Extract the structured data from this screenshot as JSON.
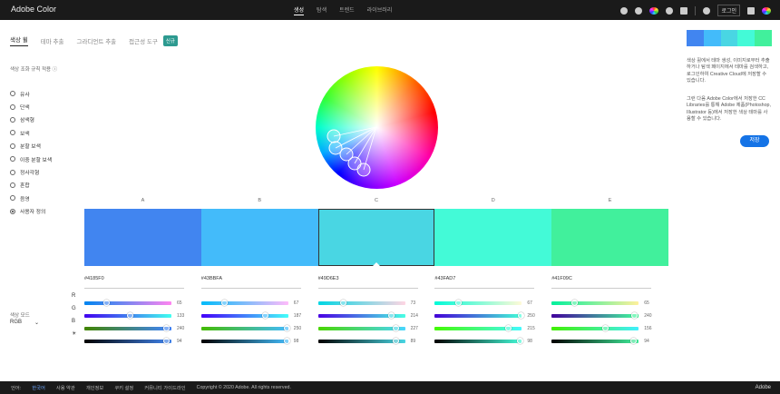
{
  "header": {
    "brand": "Adobe Color",
    "nav": [
      "생성",
      "탐색",
      "트렌드",
      "라이브러리"
    ],
    "login": "로그인"
  },
  "tabs": {
    "items": [
      "색상 휠",
      "테마 추출",
      "그라디언트 추출",
      "접근성 도구"
    ],
    "badge": "신규"
  },
  "harmony": {
    "label": "색상 조화 규칙 적용 ⓘ",
    "rules": [
      "유사",
      "단색",
      "삼색형",
      "보색",
      "분할 보색",
      "이중 분할 보색",
      "정사각형",
      "혼합",
      "음영",
      "사용자 정의"
    ],
    "selected": "사용자 정의"
  },
  "colormode": {
    "label": "색상 모드",
    "value": "RGB"
  },
  "palette": {
    "letters": [
      "A",
      "B",
      "C",
      "D",
      "E"
    ],
    "selected_index": 2,
    "swatches": [
      {
        "hex": "#4185F0",
        "color": "#4185F0",
        "r": 65,
        "g": 133,
        "b": 240,
        "br": 94
      },
      {
        "hex": "#43BBFA",
        "color": "#43BBFA",
        "r": 67,
        "g": 187,
        "b": 250,
        "br": 98
      },
      {
        "hex": "#49D6E3",
        "color": "#49D6E3",
        "r": 73,
        "g": 214,
        "b": 227,
        "br": 89
      },
      {
        "hex": "#43FAD7",
        "color": "#43FAD7",
        "r": 67,
        "g": 250,
        "b": 215,
        "br": 98
      },
      {
        "hex": "#41F09C",
        "color": "#41F09C",
        "r": 65,
        "g": 240,
        "b": 156,
        "br": 94
      }
    ]
  },
  "channels": [
    "R",
    "G",
    "B",
    "☀"
  ],
  "right_panel": {
    "text1": "색상 휠에서 테마 생성, 이미지로부터 추출하거나 탐색 페이지에서 테마를 검색하고, 로그인하여 Creative Cloud에 저장할 수 있습니다.",
    "text2": "그런 다음 Adobe Color에서 저장한 CC Libraries를 통해 Adobe 제품(Photoshop, Illustrator 등)에서 저장한 색상 테마를 사용할 수 있습니다.",
    "save": "저장"
  },
  "footer": {
    "language_label": "언어:",
    "language": "한국어",
    "links": [
      "사용 약관",
      "개인정보",
      "쿠키 설정",
      "커뮤니티 가이드라인"
    ],
    "copyright": "Copyright © 2020 Adobe. All rights reserved.",
    "adobe": "Adobe"
  }
}
